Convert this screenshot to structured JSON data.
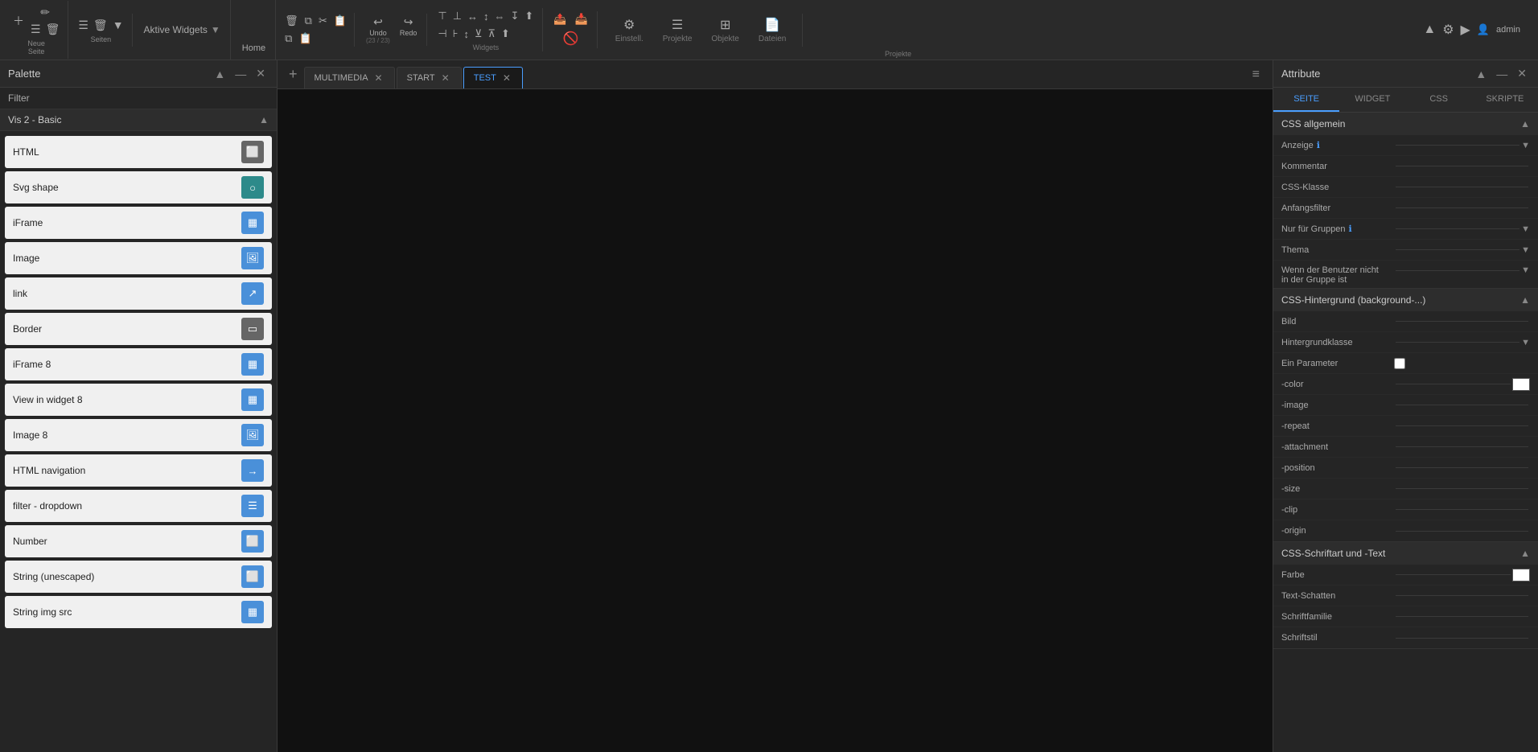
{
  "toolbar": {
    "neue_seite_label": "Neue\nSeite",
    "seiten_label": "Seiten",
    "aktive_widgets": "Aktive Widgets",
    "home_label": "Home",
    "undo_label": "Undo",
    "undo_count": "(23 / 23)",
    "redo_label": "Redo",
    "widgets_label": "Widgets",
    "einstell_label": "Einstell.",
    "projekte_label": "Projekte",
    "objekte_label": "Objekte",
    "dateien_label": "Dateien",
    "projekte_section": "Projekte",
    "user_label": "admin"
  },
  "palette": {
    "title": "Palette",
    "filter_label": "Filter",
    "section_title": "Vis 2 - Basic",
    "widgets": [
      {
        "name": "HTML",
        "icon": "⬜",
        "icon_type": "gray"
      },
      {
        "name": "Svg shape",
        "icon": "○",
        "icon_type": "teal"
      },
      {
        "name": "iFrame",
        "icon": "▦",
        "icon_type": "blue"
      },
      {
        "name": "Image",
        "icon": "🖼",
        "icon_type": "blue"
      },
      {
        "name": "link",
        "icon": "↗",
        "icon_type": "blue"
      },
      {
        "name": "Border",
        "icon": "▭",
        "icon_type": "gray"
      },
      {
        "name": "iFrame 8",
        "icon": "▦",
        "icon_type": "blue"
      },
      {
        "name": "View in widget 8",
        "icon": "▦",
        "icon_type": "blue"
      },
      {
        "name": "Image 8",
        "icon": "🖼",
        "icon_type": "blue"
      },
      {
        "name": "HTML navigation",
        "icon": "→",
        "icon_type": "blue"
      },
      {
        "name": "filter - dropdown",
        "icon": "☰",
        "icon_type": "blue"
      },
      {
        "name": "Number",
        "icon": "⬜",
        "icon_type": "blue"
      },
      {
        "name": "String (unescaped)",
        "icon": "⬜",
        "icon_type": "blue"
      },
      {
        "name": "String img src",
        "icon": "▦",
        "icon_type": "blue"
      }
    ]
  },
  "canvas": {
    "tabs": [
      {
        "id": "multimedia",
        "label": "MULTIMEDIA",
        "active": false,
        "closeable": true
      },
      {
        "id": "start",
        "label": "START",
        "active": false,
        "closeable": true
      },
      {
        "id": "test",
        "label": "TEST",
        "active": true,
        "closeable": true
      }
    ],
    "add_tab_label": "+",
    "menu_label": "≡"
  },
  "attribute": {
    "title": "Attribute",
    "tabs": [
      {
        "id": "seite",
        "label": "SEITE",
        "active": true
      },
      {
        "id": "widget",
        "label": "WIDGET",
        "active": false
      },
      {
        "id": "css",
        "label": "CSS",
        "active": false
      },
      {
        "id": "skripte",
        "label": "SKRIPTE",
        "active": false
      }
    ],
    "sections": [
      {
        "id": "css-allgemein",
        "title": "CSS allgemein",
        "expanded": true,
        "rows": [
          {
            "label": "Anzeige",
            "type": "dropdown-info",
            "value": ""
          },
          {
            "label": "Kommentar",
            "type": "line",
            "value": ""
          },
          {
            "label": "CSS-Klasse",
            "type": "line",
            "value": ""
          },
          {
            "label": "Anfangsfilter",
            "type": "line",
            "value": ""
          },
          {
            "label": "Nur für Gruppen",
            "type": "dropdown-info",
            "value": ""
          },
          {
            "label": "Thema",
            "type": "dropdown",
            "value": ""
          },
          {
            "label": "Wenn der Benutzer nicht in der Gruppe ist",
            "type": "dropdown",
            "value": ""
          }
        ]
      },
      {
        "id": "css-hintergrund",
        "title": "CSS-Hintergrund (background-...)",
        "expanded": true,
        "rows": [
          {
            "label": "Bild",
            "type": "line",
            "value": ""
          },
          {
            "label": "Hintergrundklasse",
            "type": "dropdown",
            "value": ""
          },
          {
            "label": "Ein Parameter",
            "type": "checkbox",
            "value": false
          },
          {
            "label": "-color",
            "type": "color",
            "value": "#ffffff"
          },
          {
            "label": "-image",
            "type": "line",
            "value": ""
          },
          {
            "label": "-repeat",
            "type": "line",
            "value": ""
          },
          {
            "label": "-attachment",
            "type": "line",
            "value": ""
          },
          {
            "label": "-position",
            "type": "line",
            "value": ""
          },
          {
            "label": "-size",
            "type": "line",
            "value": ""
          },
          {
            "label": "-clip",
            "type": "line",
            "value": ""
          },
          {
            "label": "-origin",
            "type": "line",
            "value": ""
          }
        ]
      },
      {
        "id": "css-schriftart",
        "title": "CSS-Schriftart und -Text",
        "expanded": true,
        "rows": [
          {
            "label": "Farbe",
            "type": "color",
            "value": "#ffffff"
          },
          {
            "label": "Text-Schatten",
            "type": "line",
            "value": ""
          },
          {
            "label": "Schriftfamilie",
            "type": "line",
            "value": ""
          },
          {
            "label": "Schriftstil",
            "type": "line",
            "value": ""
          }
        ]
      }
    ]
  }
}
